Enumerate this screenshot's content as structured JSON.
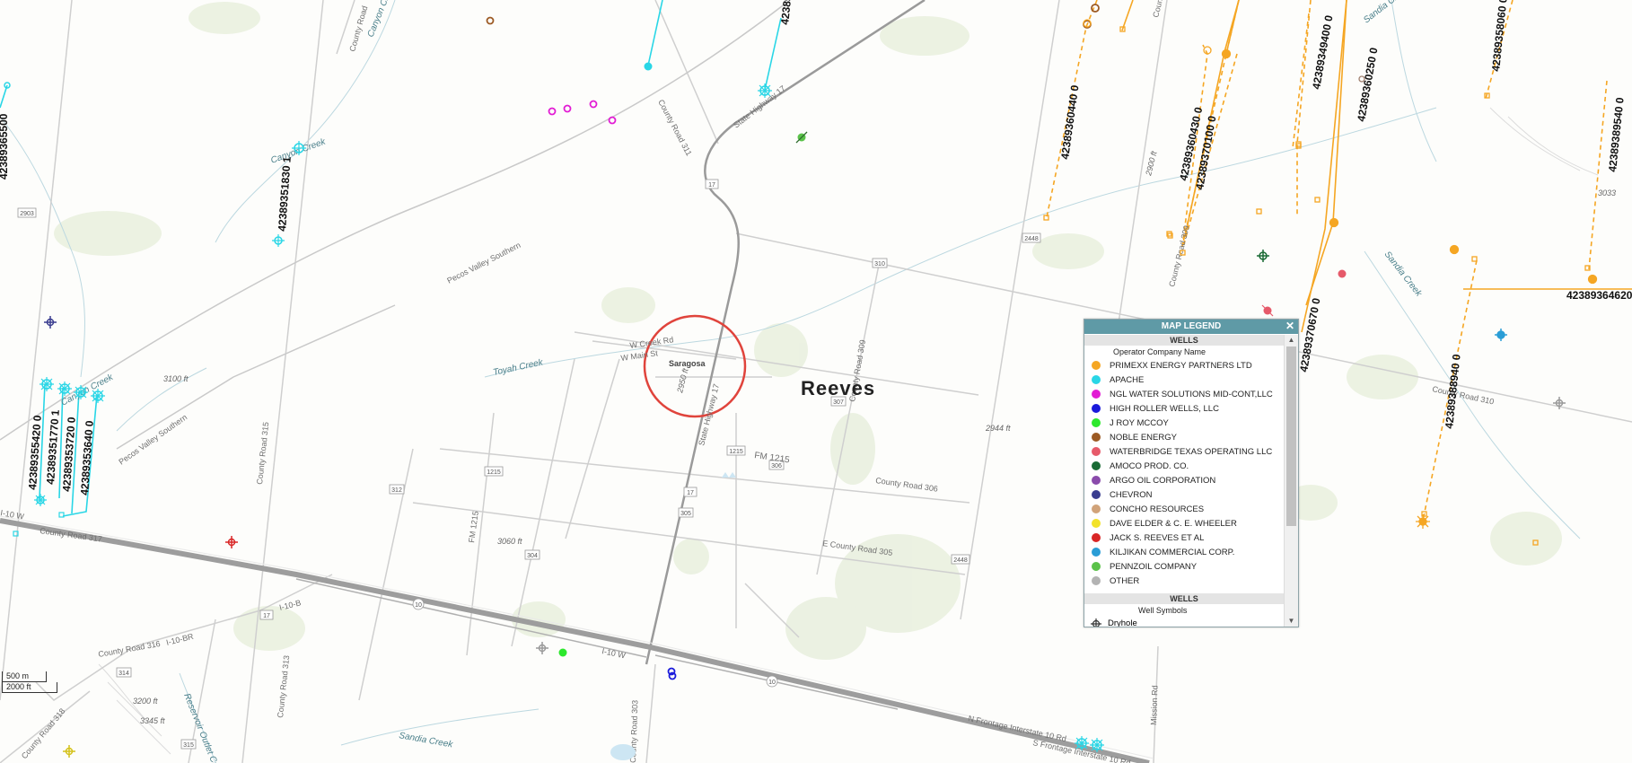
{
  "map": {
    "county_label": "Reeves",
    "town_label": "Saragosa",
    "road_labels": {
      "state_highway_17_north": "State Highway 17",
      "state_highway_17_south": "State Highway 17",
      "county_road_311": "County Road 311",
      "pecos_valley_southern_north": "Pecos Valley Southern",
      "pecos_valley_southern_south": "Pecos Valley Southern",
      "county_road_315": "County Road 315",
      "county_road_317": "County Road 317",
      "county_road_316": "County Road 316",
      "county_road_313": "County Road 313",
      "county_road_318": "County Road 318",
      "county_road_310": "County Road 310",
      "county_road_309_north": "County Road 309",
      "county_road_309": "County Road 309",
      "county_road_306": "County Road 306",
      "fm_1215": "FM 1215",
      "fm_1215_vertical": "FM 1215",
      "e_county_road_305": "E County Road 305",
      "i10_w": "I-10 W",
      "i10_w_left": "I-10 W",
      "i10_br": "I-10-BR",
      "i10_b": "I-10-B",
      "w_creek_rd": "W Creek Rd",
      "w_main_st": "W Main St",
      "n_frontage": "N Frontage Interstate 10 Rd",
      "s_frontage": "S Frontage Interstate 10 Rd",
      "mission_rd": "Mission Rd",
      "county_road_303": "County Road 303",
      "county_road_top": "County Road",
      "county_road_30": "County Road 30"
    },
    "creek_labels": {
      "canyon_creek_top": "Canyon Creek",
      "canyon_creek_mid": "Canyon Creek",
      "canyon_creek_left": "Canyon Creek",
      "toyah_creek": "Toyah Creek",
      "sandia_creek_east": "Sandia Creek",
      "sandia_creek_top": "Sandia Creek",
      "sandia_creek_south": "Sandia Creek",
      "reservoir_outlet": "Reservoir Outlet Can"
    },
    "elevation_labels": {
      "e3100": "3100 ft",
      "e3060": "3060 ft",
      "e2944": "2944 ft",
      "e3200": "3200 ft",
      "e3345": "3345 ft",
      "e3033": "3033",
      "e2950": "2950 ft",
      "e2900": "2900 ft"
    },
    "shields": {
      "s17a": "17",
      "s17b": "17",
      "s17c": "17",
      "s17d": "17",
      "s310": "310",
      "s307": "307",
      "s1215a": "1215",
      "s1215b": "1215",
      "s306": "306",
      "s305": "305",
      "s304": "304",
      "s312": "312",
      "s2448a": "2448",
      "s2448b": "2448",
      "s2903": "2903",
      "s10a": "10",
      "s10b": "10",
      "s314": "314",
      "s315": "315"
    },
    "well_labels": {
      "w_3400": "42389353400",
      "w_3500": "42389365500",
      "w_3518301": "42389351830 1",
      "w_3554200": "42389355420 0",
      "w_3517701": "42389351770 1",
      "w_3537200": "42389353720 0",
      "w_3536400": "42389353640 0",
      "w_3604400": "42389360440 0",
      "w_3604300": "42389360430 0",
      "w_3701000": "42389370100 0",
      "w_3494000": "42389349400 0",
      "w_3602500": "42389360250 0",
      "w_3580600": "42389358060 0",
      "w_3895400": "42389389540 0",
      "w_3706700": "42389370670 0",
      "w_3889400": "42389388940 0",
      "w_3646200": "42389364620 0",
      "w_3600": "4238936..."
    }
  },
  "legend": {
    "title": "MAP LEGEND",
    "close_icon": "close-icon",
    "section_wells": "WELLS",
    "subheading_operator": "Operator Company Name",
    "operators": [
      {
        "name": "PRIMEXX ENERGY PARTNERS LTD",
        "color": "#f5a623"
      },
      {
        "name": "APACHE",
        "color": "#29d6e6"
      },
      {
        "name": "NGL WATER SOLUTIONS MID-CONT,LLC",
        "color": "#e21cd4"
      },
      {
        "name": "HIGH ROLLER WELLS, LLC",
        "color": "#1a1adb"
      },
      {
        "name": "J ROY MCCOY",
        "color": "#2de82d"
      },
      {
        "name": "NOBLE ENERGY",
        "color": "#9c5a24"
      },
      {
        "name": "WATERBRIDGE TEXAS OPERATING LLC",
        "color": "#e65a6a"
      },
      {
        "name": "AMOCO PROD. CO.",
        "color": "#1a6b35"
      },
      {
        "name": "ARGO OIL CORPORATION",
        "color": "#8a4bab"
      },
      {
        "name": "CHEVRON",
        "color": "#3a3d8f"
      },
      {
        "name": "CONCHO RESOURCES",
        "color": "#d1a37a"
      },
      {
        "name": "DAVE ELDER & C. E. WHEELER",
        "color": "#f2e22a"
      },
      {
        "name": "JACK S. REEVES ET AL",
        "color": "#d92626"
      },
      {
        "name": "KILJIKAN COMMERCIAL CORP.",
        "color": "#2a9dd6"
      },
      {
        "name": "PENNZOIL COMPANY",
        "color": "#5bc24a"
      },
      {
        "name": "OTHER",
        "color": "#b3b3b3"
      }
    ],
    "section_wells_2": "WELLS",
    "subheading_symbols": "Well Symbols",
    "symbol_dryhole": "Dryhole"
  },
  "scale": {
    "metric": "500 m",
    "imperial": "2000 ft"
  }
}
